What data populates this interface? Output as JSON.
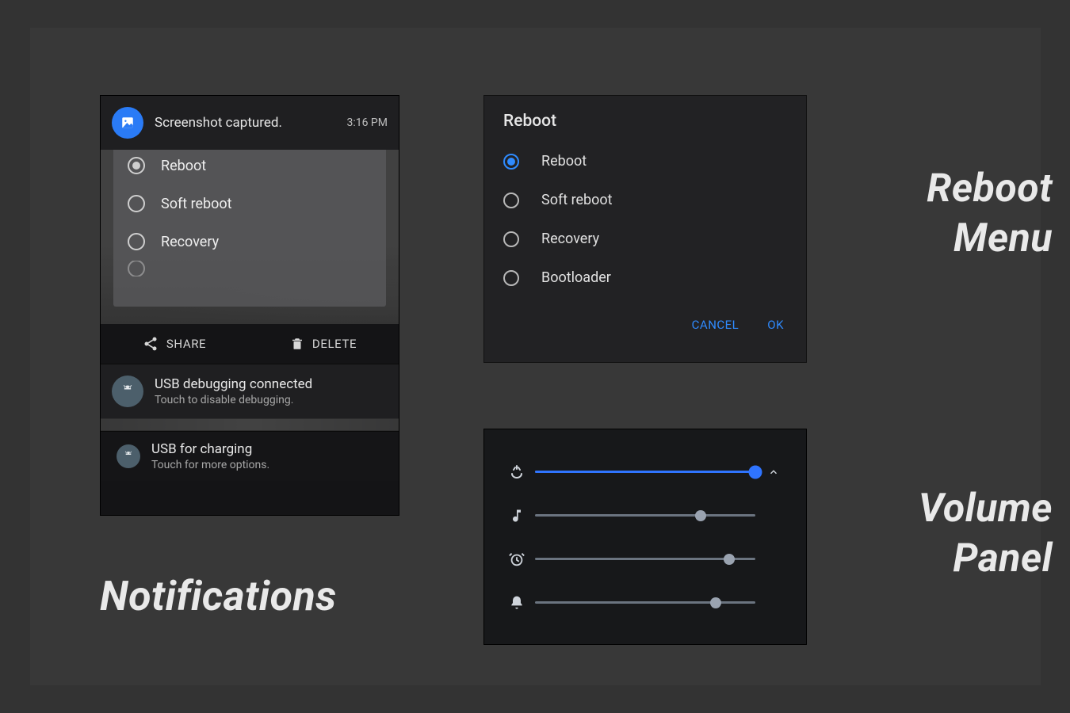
{
  "labels": {
    "notifications": "Notifications",
    "reboot_menu_l1": "Reboot",
    "reboot_menu_l2": "Menu",
    "volume_panel_l1": "Volume",
    "volume_panel_l2": "Panel"
  },
  "colors": {
    "accent": "#2f8bff",
    "slider_active": "#2f74ff"
  },
  "notification_card": {
    "header": {
      "icon": "image-icon",
      "title": "Screenshot captured.",
      "time": "3:16 PM"
    },
    "preview_list": {
      "items": [
        {
          "label": "Reboot",
          "selected": true
        },
        {
          "label": "Soft reboot",
          "selected": false
        },
        {
          "label": "Recovery",
          "selected": false
        }
      ]
    },
    "actions": {
      "share": "SHARE",
      "delete": "DELETE"
    },
    "items": [
      {
        "icon": "android-icon",
        "title": "USB debugging connected",
        "subtitle": "Touch to disable debugging."
      },
      {
        "icon": "android-icon",
        "title": "USB for charging",
        "subtitle": "Touch for more options."
      }
    ]
  },
  "reboot_dialog": {
    "title": "Reboot",
    "options": [
      {
        "label": "Reboot",
        "selected": true
      },
      {
        "label": "Soft reboot",
        "selected": false
      },
      {
        "label": "Recovery",
        "selected": false
      },
      {
        "label": "Bootloader",
        "selected": false
      }
    ],
    "cancel": "CANCEL",
    "ok": "OK"
  },
  "volume_panel": {
    "rows": [
      {
        "icon": "ringer-icon",
        "value_pct": 100,
        "active": true,
        "expand": "chevron-up-icon"
      },
      {
        "icon": "music-note-icon",
        "value_pct": 75,
        "active": false
      },
      {
        "icon": "alarm-clock-icon",
        "value_pct": 88,
        "active": false
      },
      {
        "icon": "bell-icon",
        "value_pct": 82,
        "active": false
      }
    ]
  }
}
